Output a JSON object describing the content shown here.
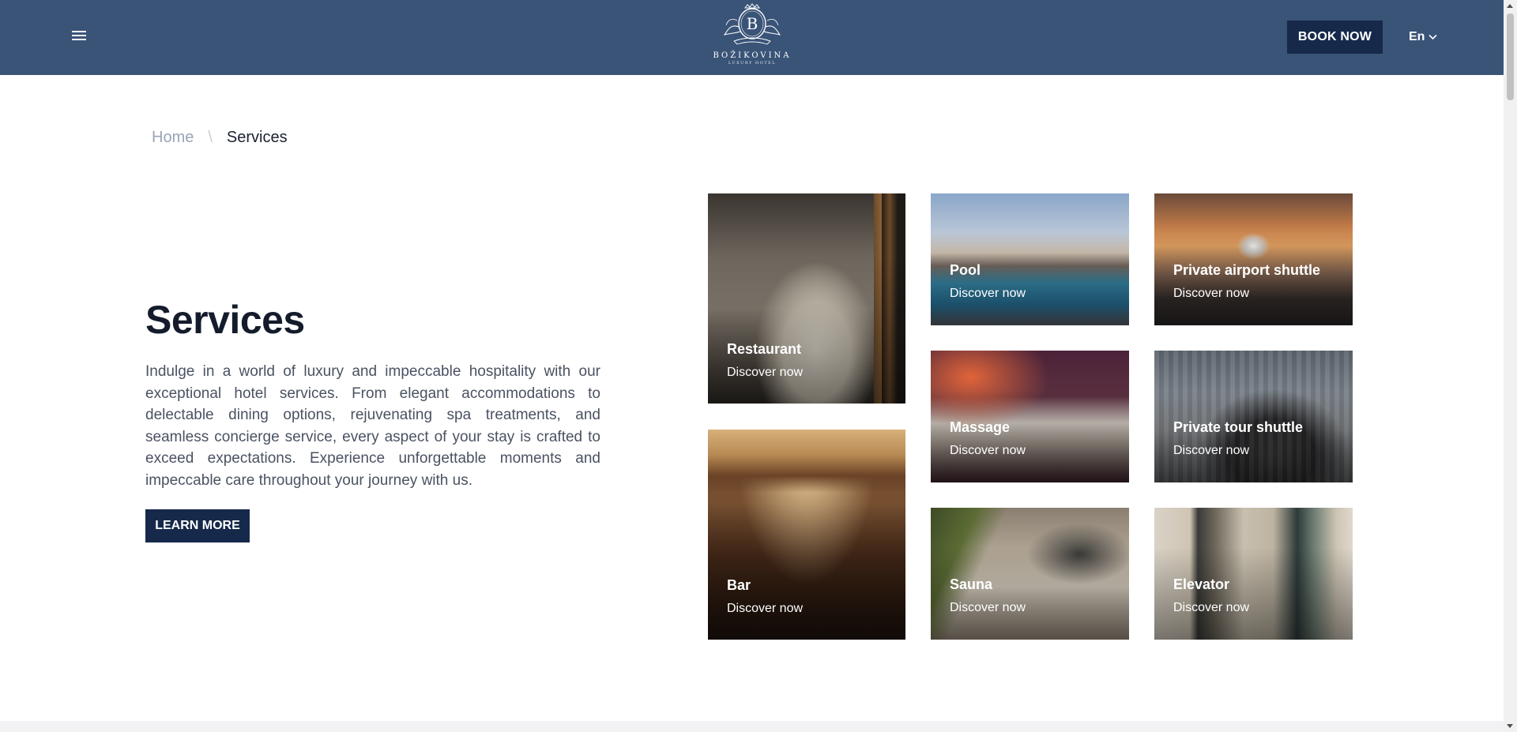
{
  "header": {
    "logo": {
      "letter": "B",
      "name": "BOŽIKOVINA",
      "subtitle": "LUXURY HOTEL"
    },
    "book_label": "BOOK NOW",
    "language": "En",
    "menu_icon": "hamburger-icon",
    "language_icon": "chevron-down-icon"
  },
  "breadcrumb": {
    "home": "Home",
    "separator": "\\",
    "current": "Services"
  },
  "intro": {
    "title": "Services",
    "text": "Indulge in a world of luxury and impeccable hospitality with our exceptional hotel services. From elegant accommodations to delectable dining options, rejuvenating spa treatments, and seamless concierge service, every aspect of your stay is crafted to exceed expectations. Experience unforgettable moments and impeccable care throughout your journey with us.",
    "button_label": "LEARN MORE"
  },
  "services": [
    {
      "title": "Restaurant",
      "link": "Discover now"
    },
    {
      "title": "Bar",
      "link": "Discover now"
    },
    {
      "title": "Pool",
      "link": "Discover now"
    },
    {
      "title": "Massage",
      "link": "Discover now"
    },
    {
      "title": "Sauna",
      "link": "Discover now"
    },
    {
      "title": "Private airport shuttle",
      "link": "Discover now"
    },
    {
      "title": "Private tour shuttle",
      "link": "Discover now"
    },
    {
      "title": "Elevator",
      "link": "Discover now"
    }
  ],
  "colors": {
    "header_bg": "#3a5478",
    "button_bg": "#16294a",
    "heading": "#141c2c",
    "body_text": "#4a5262"
  }
}
